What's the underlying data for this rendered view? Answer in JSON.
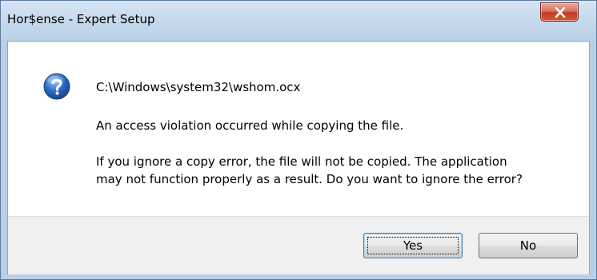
{
  "window": {
    "title": "Hor$ense - Expert Setup"
  },
  "dialog": {
    "icon": "question-icon",
    "file_path": "C:\\Windows\\system32\\wshom.ocx",
    "error_message": "An access violation occurred while copying the file.",
    "prompt_line1": "If you ignore a copy error, the file will not be copied.  The application",
    "prompt_line2": "may not function properly as a result.  Do you want to ignore the error?"
  },
  "buttons": {
    "yes_label": "Yes",
    "no_label": "No"
  },
  "colors": {
    "close_button": "#c23b22",
    "icon_blue": "#2a66c2",
    "default_button_border": "#3c7fb1"
  }
}
